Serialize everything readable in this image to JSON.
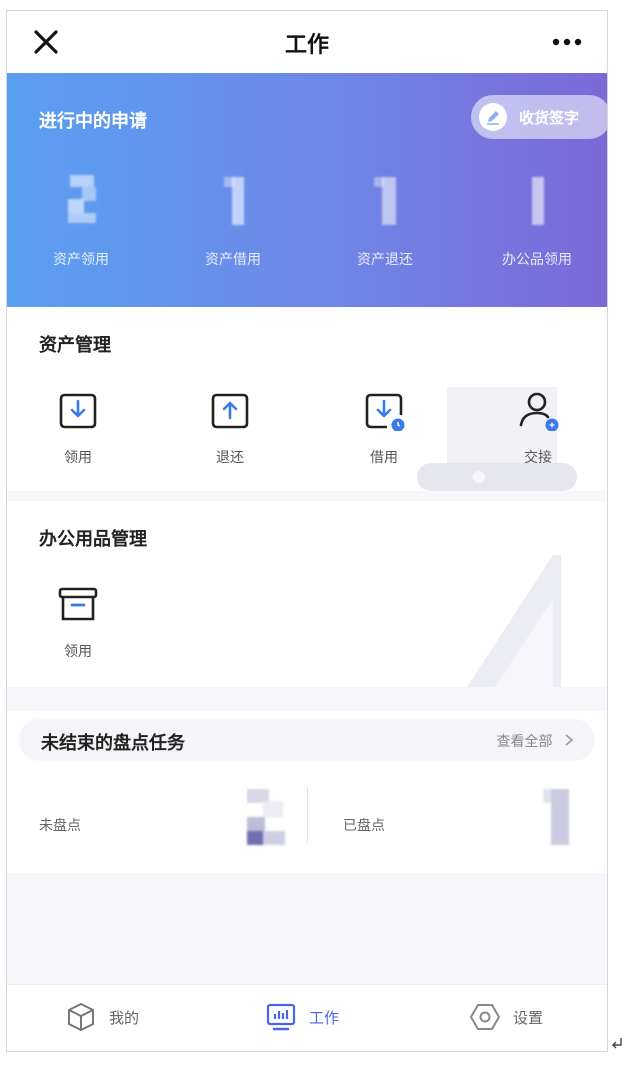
{
  "header": {
    "title": "工作"
  },
  "banner": {
    "title": "进行中的申请",
    "sign_button_label": "收货签字",
    "stats": [
      {
        "label": "资产领用"
      },
      {
        "label": "资产借用"
      },
      {
        "label": "资产退还"
      },
      {
        "label": "办公品领用"
      }
    ]
  },
  "asset_management": {
    "title": "资产管理",
    "items": [
      {
        "label": "领用",
        "icon": "download-box-icon"
      },
      {
        "label": "退还",
        "icon": "upload-box-icon"
      },
      {
        "label": "借用",
        "icon": "borrow-box-icon"
      },
      {
        "label": "交接",
        "icon": "handover-user-icon"
      }
    ]
  },
  "office_supplies": {
    "title": "办公用品管理",
    "items": [
      {
        "label": "领用",
        "icon": "archive-box-icon"
      }
    ]
  },
  "inventory_tasks": {
    "title": "未结束的盘点任务",
    "view_all": "查看全部",
    "cells": [
      {
        "label": "未盘点"
      },
      {
        "label": "已盘点"
      }
    ]
  },
  "tabbar": {
    "tabs": [
      {
        "label": "我的",
        "icon": "cube-icon",
        "active": false
      },
      {
        "label": "工作",
        "icon": "dashboard-icon",
        "active": true
      },
      {
        "label": "设置",
        "icon": "settings-hex-icon",
        "active": false
      }
    ]
  },
  "colors": {
    "banner_start": "#5aa0f2",
    "banner_end": "#7b69d8",
    "accent": "#4a63e8",
    "icon_blue": "#3a7bea"
  }
}
